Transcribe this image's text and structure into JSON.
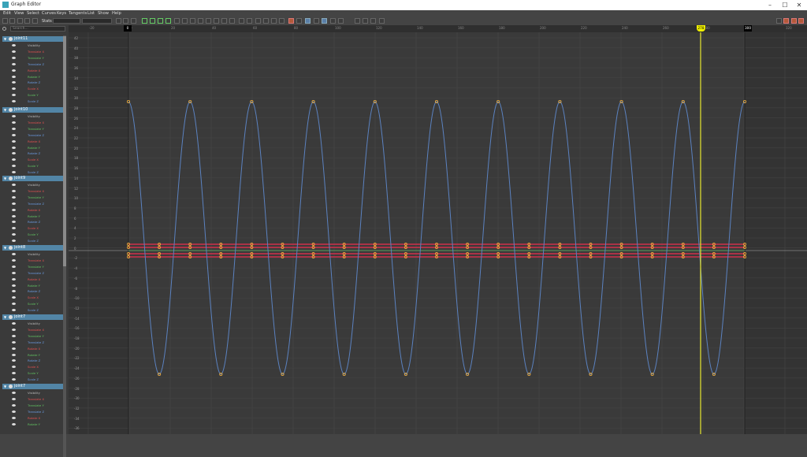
{
  "window": {
    "title": "Graph Editor",
    "controls": [
      "–",
      "☐",
      "✕"
    ]
  },
  "menu": [
    "Edit",
    "View",
    "Select",
    "Curves",
    "Keys",
    "Tangents",
    "List",
    "Show",
    "Help"
  ],
  "toolbar": {
    "stats_label": "Stats"
  },
  "outliner": {
    "search_placeholder": "Search...",
    "joints": [
      {
        "name": "joint11",
        "channels": [
          "Visibility",
          "Translate X",
          "Translate Y",
          "Translate Z",
          "Rotate X",
          "Rotate Y",
          "Rotate Z",
          "Scale X",
          "Scale Y",
          "Scale Z"
        ]
      },
      {
        "name": "joint10",
        "channels": [
          "Visibility",
          "Translate X",
          "Translate Y",
          "Translate Z",
          "Rotate X",
          "Rotate Y",
          "Rotate Z",
          "Scale X",
          "Scale Y",
          "Scale Z"
        ]
      },
      {
        "name": "joint9",
        "channels": [
          "Visibility",
          "Translate X",
          "Translate Y",
          "Translate Z",
          "Rotate X",
          "Rotate Y",
          "Rotate Z",
          "Scale X",
          "Scale Y",
          "Scale Z"
        ]
      },
      {
        "name": "joint8",
        "channels": [
          "Visibility",
          "Translate X",
          "Translate Y",
          "Translate Z",
          "Rotate X",
          "Rotate Y",
          "Rotate Z",
          "Scale X",
          "Scale Y",
          "Scale Z"
        ]
      },
      {
        "name": "joint7",
        "channels": [
          "Visibility",
          "Translate X",
          "Translate Y",
          "Translate Z",
          "Rotate X",
          "Rotate Y",
          "Rotate Z",
          "Scale X",
          "Scale Y",
          "Scale Z"
        ]
      },
      {
        "name": "joint7",
        "channels": [
          "Visibility",
          "Translate X",
          "Translate Y",
          "Translate Z",
          "Rotate X",
          "Rotate Y"
        ]
      }
    ],
    "channel_colors": {
      "Visibility": "#bbbbbb",
      "X": "#e05050",
      "Y": "#60c060",
      "Z": "#6a9ae0"
    }
  },
  "graph": {
    "current_frame": "278",
    "end_frame": "300",
    "start_frame": "0",
    "frame_ticks": [
      "-20",
      "0",
      "20",
      "40",
      "60",
      "80",
      "100",
      "120",
      "140",
      "160",
      "180",
      "200",
      "220",
      "240",
      "260",
      "280",
      "300",
      "320"
    ],
    "value_ticks": [
      "42",
      "40",
      "38",
      "36",
      "34",
      "32",
      "30",
      "28",
      "26",
      "24",
      "22",
      "20",
      "18",
      "16",
      "14",
      "12",
      "10",
      "8",
      "6",
      "4",
      "2",
      "0",
      "-2",
      "-4",
      "-6",
      "-8",
      "-10",
      "-12",
      "-14",
      "-16",
      "-18",
      "-20",
      "-22",
      "-24",
      "-26",
      "-28",
      "-30",
      "-32",
      "-34",
      "-36"
    ],
    "curve_color": "#5b82c0",
    "key_color": "#e6a83c",
    "flat_curve_color": "#d0304a",
    "time_cursor_color": "#e8e830"
  }
}
